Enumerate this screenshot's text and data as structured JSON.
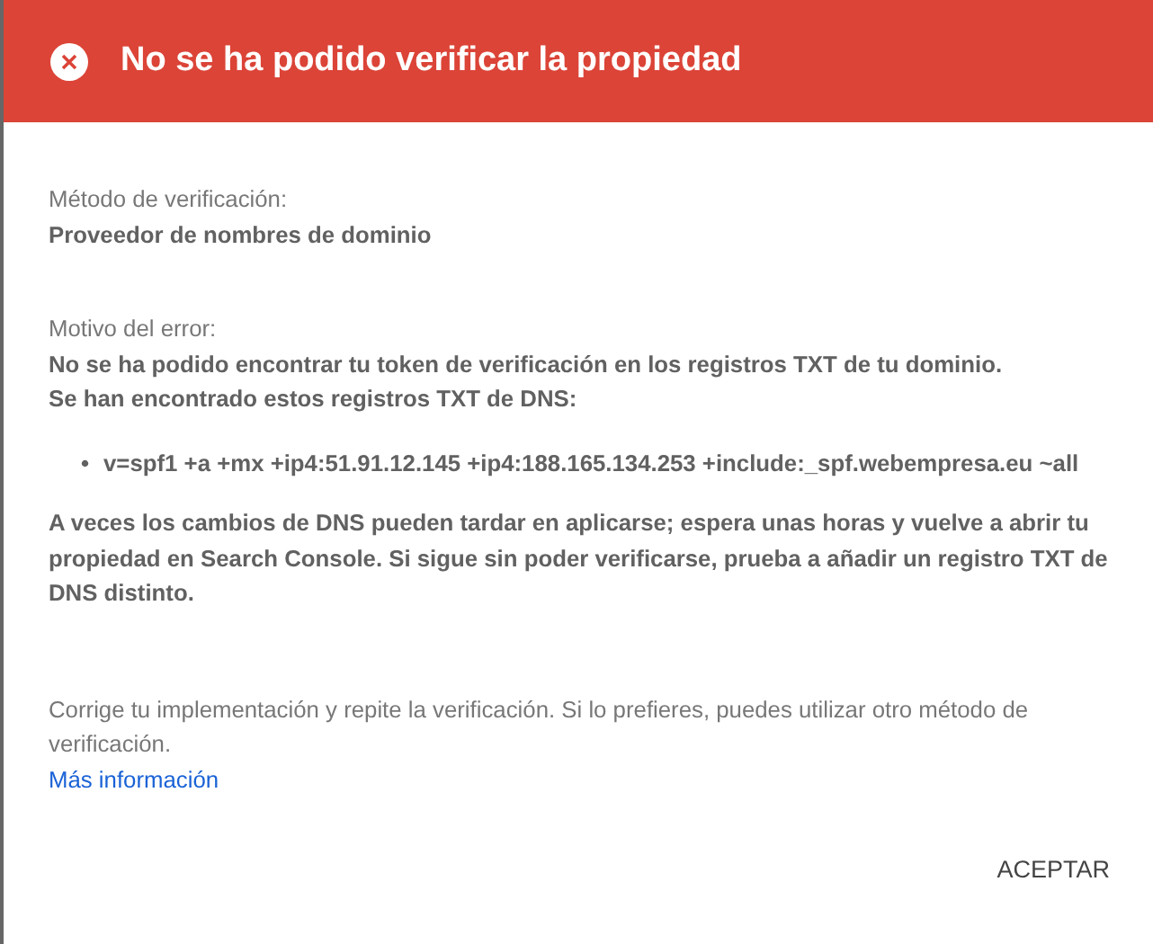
{
  "dialog": {
    "title": "No se ha podido verificar la propiedad",
    "method": {
      "label": "Método de verificación:",
      "value": "Proveedor de nombres de dominio"
    },
    "error": {
      "label": "Motivo del error:",
      "lines": [
        "No se ha podido encontrar tu token de verificación en los registros TXT de tu dominio.",
        "Se han encontrado estos registros TXT de DNS:"
      ],
      "records": [
        {
          "bullet": "•",
          "text": "v=spf1 +a +mx +ip4:51.91.12.145 +ip4:188.165.134.253 +include:_spf.webempresa.eu ~all"
        }
      ],
      "note": "A veces los cambios de DNS pueden tardar en aplicarse; espera unas horas y vuelve a abrir tu propiedad en Search Console. Si sigue sin poder verificarse, prueba a añadir un registro TXT de DNS distinto."
    },
    "help": "Corrige tu implementación y repite la verificación. Si lo prefieres, puedes utilizar otro método de verificación.",
    "link": "Más información",
    "buttons": [
      "ACEPTAR"
    ]
  }
}
